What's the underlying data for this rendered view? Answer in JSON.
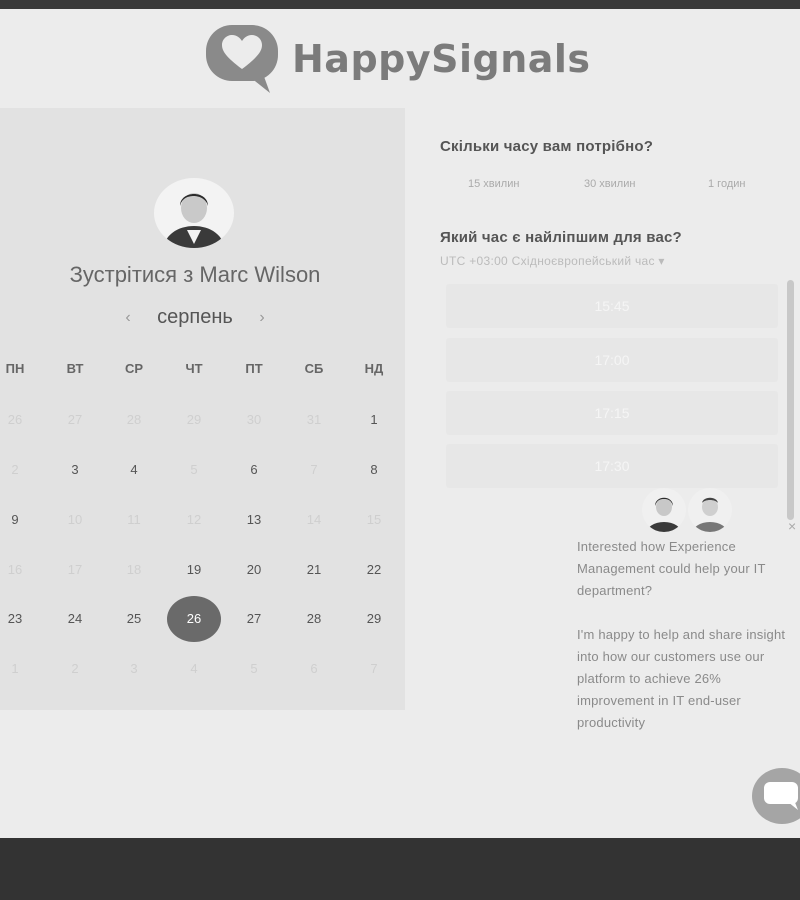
{
  "brand": {
    "name": "HappySignals"
  },
  "booking": {
    "meet_title": "Зустрітися з Marc Wilson",
    "month": "серпень",
    "prev_icon": "‹",
    "next_icon": "›",
    "weekdays": [
      "ПН",
      "ВТ",
      "СР",
      "ЧТ",
      "ПТ",
      "СБ",
      "НД"
    ],
    "weeks": [
      [
        {
          "d": "26",
          "muted": true
        },
        {
          "d": "27",
          "muted": true
        },
        {
          "d": "28",
          "muted": true
        },
        {
          "d": "29",
          "muted": true
        },
        {
          "d": "30",
          "muted": true
        },
        {
          "d": "31",
          "muted": true
        },
        {
          "d": "1",
          "muted": false
        }
      ],
      [
        {
          "d": "2",
          "muted": true
        },
        {
          "d": "3",
          "muted": false
        },
        {
          "d": "4",
          "muted": false
        },
        {
          "d": "5",
          "muted": true
        },
        {
          "d": "6",
          "muted": false
        },
        {
          "d": "7",
          "muted": true
        },
        {
          "d": "8",
          "muted": false
        }
      ],
      [
        {
          "d": "9",
          "muted": false
        },
        {
          "d": "10",
          "muted": true
        },
        {
          "d": "11",
          "muted": true
        },
        {
          "d": "12",
          "muted": true
        },
        {
          "d": "13",
          "muted": false
        },
        {
          "d": "14",
          "muted": true
        },
        {
          "d": "15",
          "muted": true
        }
      ],
      [
        {
          "d": "16",
          "muted": true
        },
        {
          "d": "17",
          "muted": true
        },
        {
          "d": "18",
          "muted": true
        },
        {
          "d": "19",
          "muted": false
        },
        {
          "d": "20",
          "muted": false
        },
        {
          "d": "21",
          "muted": false
        },
        {
          "d": "22",
          "muted": false
        }
      ],
      [
        {
          "d": "23",
          "muted": false
        },
        {
          "d": "24",
          "muted": false
        },
        {
          "d": "25",
          "muted": false
        },
        {
          "d": "26",
          "muted": false,
          "selected": true
        },
        {
          "d": "27",
          "muted": false
        },
        {
          "d": "28",
          "muted": false
        },
        {
          "d": "29",
          "muted": false
        }
      ],
      [
        {
          "d": "1",
          "muted": true
        },
        {
          "d": "2",
          "muted": true
        },
        {
          "d": "3",
          "muted": true
        },
        {
          "d": "4",
          "muted": true
        },
        {
          "d": "5",
          "muted": true
        },
        {
          "d": "6",
          "muted": true
        },
        {
          "d": "7",
          "muted": true
        }
      ]
    ],
    "duration_question": "Скільки часу вам потрібно?",
    "durations": [
      "15 хвилин",
      "30 хвилин",
      "1 годин"
    ],
    "time_question": "Який час є найліпшим для вас?",
    "timezone": "UTC +03:00 Східноєвропейський час  ▾",
    "slots": [
      "15:45",
      "17:00",
      "17:15",
      "17:30"
    ]
  },
  "chat": {
    "close": "×",
    "message_1": "Interested how Experience Management could help your IT department?",
    "message_2": "I'm happy to help and share insight into how our customers use our platform to achieve 26% improvement in IT end-user productivity"
  },
  "colors": {
    "selected_day": "#6a6a6a",
    "panel": "#e2e2e2",
    "page": "#ececec"
  }
}
